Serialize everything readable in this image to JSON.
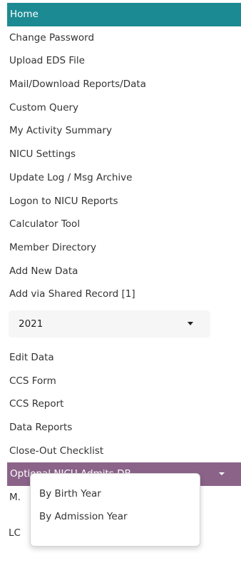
{
  "nav": {
    "items": [
      {
        "label": "Home",
        "active": true
      },
      {
        "label": "Change Password"
      },
      {
        "label": "Upload EDS File"
      },
      {
        "label": "Mail/Download Reports/Data"
      },
      {
        "label": "Custom Query"
      },
      {
        "label": "My Activity Summary"
      },
      {
        "label": "NICU Settings"
      },
      {
        "label": "Update Log / Msg Archive"
      },
      {
        "label": "Logon to NICU Reports"
      },
      {
        "label": "Calculator Tool"
      },
      {
        "label": "Member Directory"
      },
      {
        "label": "Add New Data"
      },
      {
        "label": "Add via Shared Record [1]"
      }
    ],
    "year_select": {
      "value": "2021"
    },
    "items_after_select": [
      {
        "label": "Edit Data"
      },
      {
        "label": "CCS Form"
      },
      {
        "label": "CCS Report"
      },
      {
        "label": "Data Reports"
      },
      {
        "label": "Close-Out Checklist"
      }
    ],
    "optional_db": {
      "label": "Optional NICU Admits DB",
      "color": "#8b6389"
    },
    "truncated_item_1": "M.",
    "truncated_item_2": "LC"
  },
  "dropdown": {
    "items": [
      {
        "label": "By Birth Year"
      },
      {
        "label": "By Admission Year"
      }
    ]
  },
  "colors": {
    "active_bg": "#1c8a93",
    "purple_bg": "#8b6389"
  }
}
